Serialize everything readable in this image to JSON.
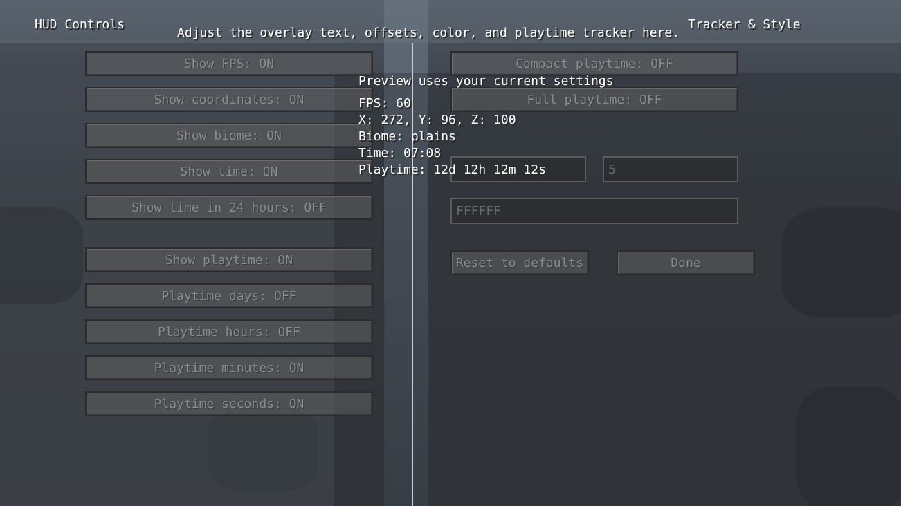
{
  "header": {
    "left_title": "HUD Controls",
    "right_title": "Tracker & Style",
    "subtitle": "Adjust the overlay text, offsets, color, and playtime tracker here."
  },
  "left_buttons": [
    {
      "label": "Show FPS: ON"
    },
    {
      "label": "Show coordinates: ON"
    },
    {
      "label": "Show biome: ON"
    },
    {
      "label": "Show time: ON"
    },
    {
      "label": "Show time in 24 hours: OFF"
    },
    {
      "label": "Show playtime: ON"
    },
    {
      "label": "Playtime days: OFF"
    },
    {
      "label": "Playtime hours: OFF"
    },
    {
      "label": "Playtime minutes: ON"
    },
    {
      "label": "Playtime seconds: ON"
    }
  ],
  "right_buttons": {
    "compact": "Compact playtime: OFF",
    "full": "Full playtime: OFF",
    "reset": "Reset to defaults",
    "done": "Done"
  },
  "fields": {
    "offset_x": "",
    "offset_y": "5",
    "color": "FFFFFF"
  },
  "preview": {
    "heading": "Preview uses your current settings",
    "fps": "FPS: 60",
    "coords": "X: 272, Y: 96, Z: 100",
    "biome": "Biome: plains",
    "time": "Time: 07:08",
    "playtime": "Playtime: 12d 12h 12m 12s"
  }
}
